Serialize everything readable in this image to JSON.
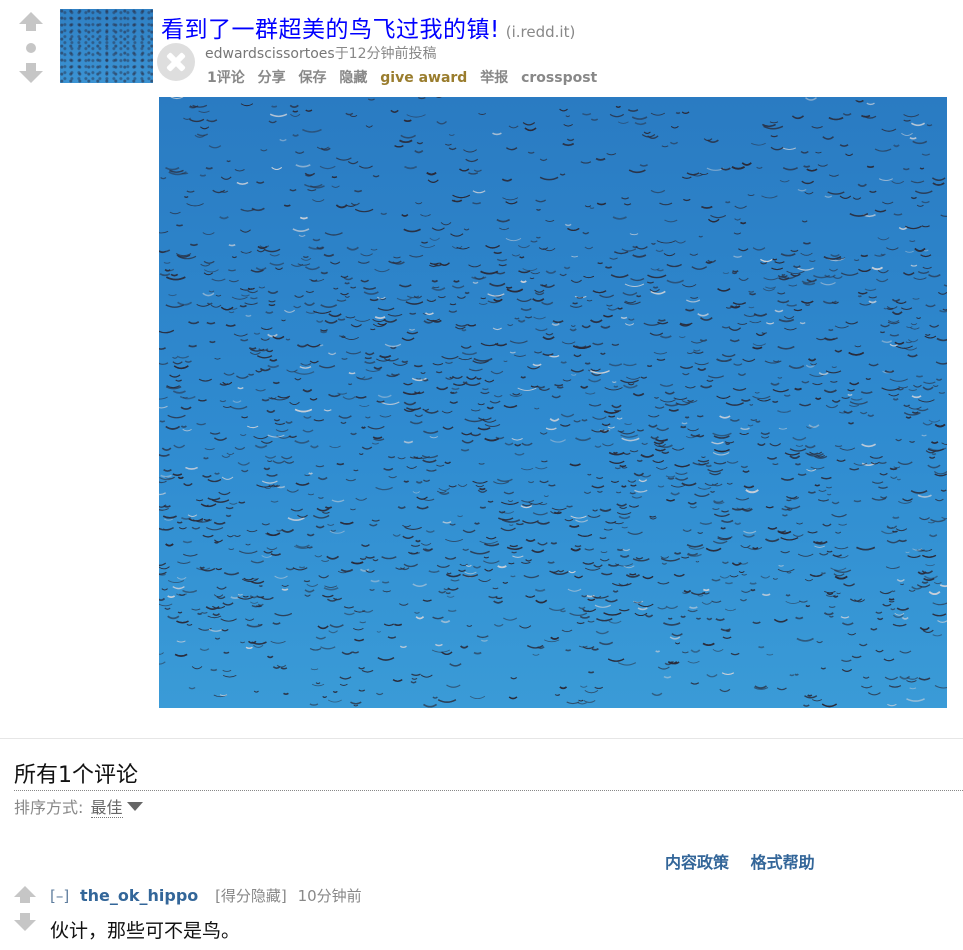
{
  "post": {
    "title": "看到了一群超美的鸟飞过我的镇!",
    "domain": "(i.redd.it)",
    "author": "edwardscissortoes",
    "tagline_suffix": "于12分钟前投稿",
    "buttons": {
      "comments": "1评论",
      "share": "分享",
      "save": "保存",
      "hide": "隐藏",
      "give_award": "give award",
      "report": "举报",
      "crosspost": "crosspost"
    },
    "icons": {
      "upvote": "upvote-arrow-icon",
      "downvote": "downvote-arrow-icon",
      "close": "close-x-icon"
    }
  },
  "comments_section": {
    "title": "所有1个评论",
    "sort_label": "排序方式:",
    "sort_value": "最佳",
    "links": {
      "content_policy": "内容政策",
      "format_help": "格式帮助"
    }
  },
  "comments": [
    {
      "toggle": "[–]",
      "author": "the_ok_hippo",
      "score": "[得分隐藏]",
      "time": "10分钟前",
      "body": "伙计，那些可不是鸟。"
    }
  ],
  "colors": {
    "title_link": "#0000ff",
    "award": "#9a7d2e",
    "comment_author": "#336699",
    "sky": "#2f8bd0"
  }
}
